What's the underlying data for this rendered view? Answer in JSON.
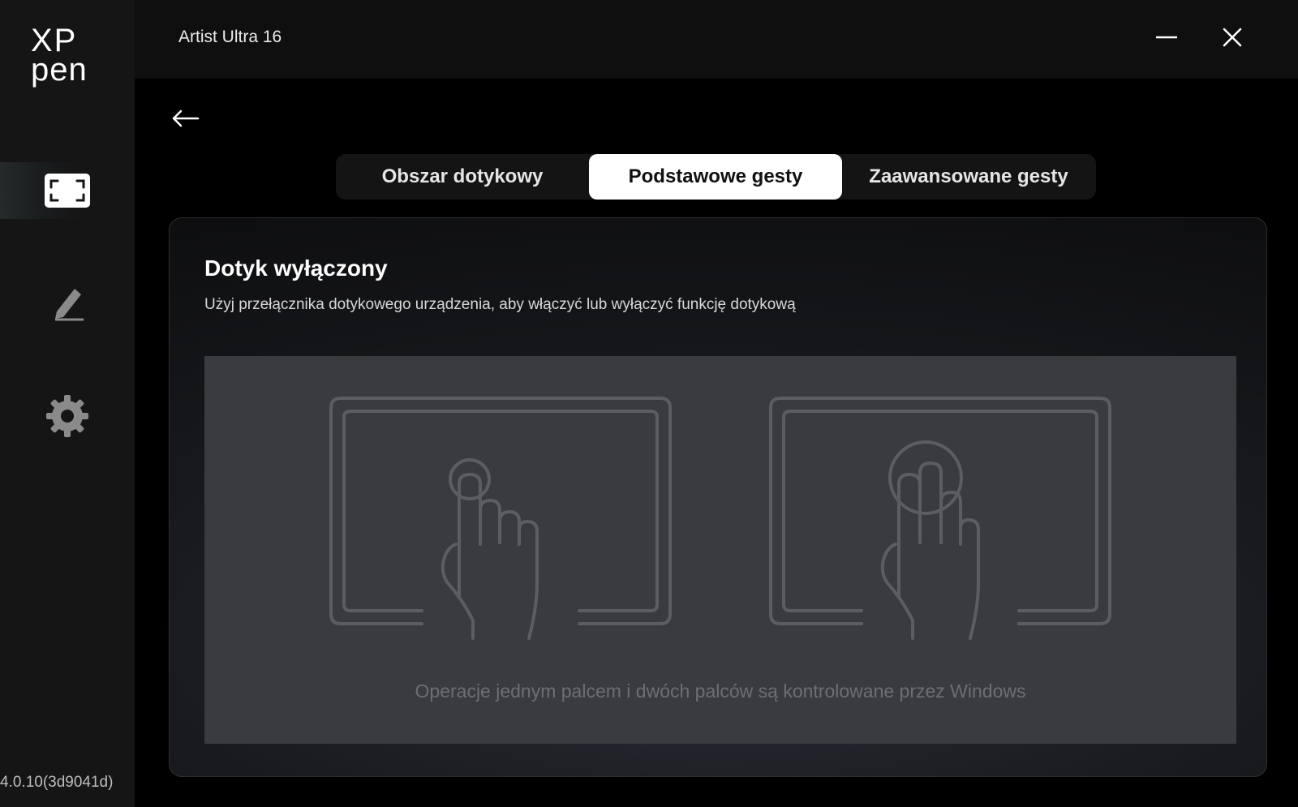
{
  "app": {
    "brand_line1": "XP",
    "brand_line2": "pen",
    "window_title": "Artist Ultra 16",
    "version": "4.0.10(3d9041d)"
  },
  "sidebar": {
    "items": [
      {
        "name": "display-icon",
        "active": true
      },
      {
        "name": "pen-icon",
        "active": false
      },
      {
        "name": "gear-icon",
        "active": false
      }
    ]
  },
  "tabs": [
    {
      "label": "Obszar dotykowy",
      "selected": false
    },
    {
      "label": "Podstawowe gesty",
      "selected": true
    },
    {
      "label": "Zaawansowane gesty",
      "selected": false
    }
  ],
  "panel": {
    "title": "Dotyk wyłączony",
    "description": "Użyj przełącznika dotykowego urządzenia, aby włączyć lub wyłączyć funkcję dotykową",
    "caption": "Operacje jednym palcem i dwóch palców są kontrolowane przez Windows"
  },
  "colors": {
    "background": "#000000",
    "sidebar": "#151515",
    "selected_tab": "#ffffff",
    "illustration_bg": "#3a3b3e",
    "illustration_stroke": "#5c5d61"
  }
}
